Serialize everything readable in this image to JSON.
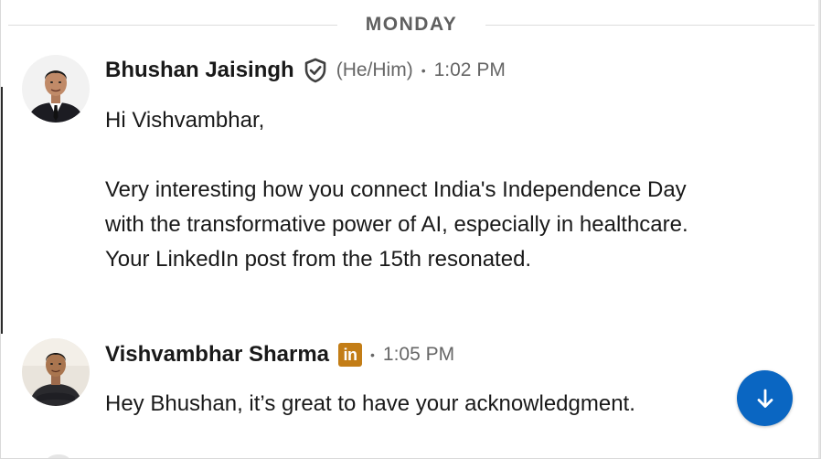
{
  "divider": {
    "label": "MONDAY"
  },
  "messages": [
    {
      "sender": "Bhushan Jaisingh",
      "pronouns": "(He/Him)",
      "separator": "•",
      "time": "1:02 PM",
      "badge_icon": "verified-shield-icon",
      "paragraphs": [
        "Hi Vishvambhar,",
        "Very interesting how you connect India's Independence Day with the transformative power of AI, especially in healthcare. Your LinkedIn post from the 15th resonated."
      ]
    },
    {
      "sender": "Vishvambhar Sharma",
      "badge": "in",
      "badge_color": "#c37d16",
      "separator": "•",
      "time": "1:05 PM",
      "paragraphs": [
        "Hey Bhushan, it’s great to have your acknowledgment."
      ]
    }
  ],
  "scroll_button": {
    "icon": "arrow-down-icon",
    "color": "#0a66c2"
  }
}
